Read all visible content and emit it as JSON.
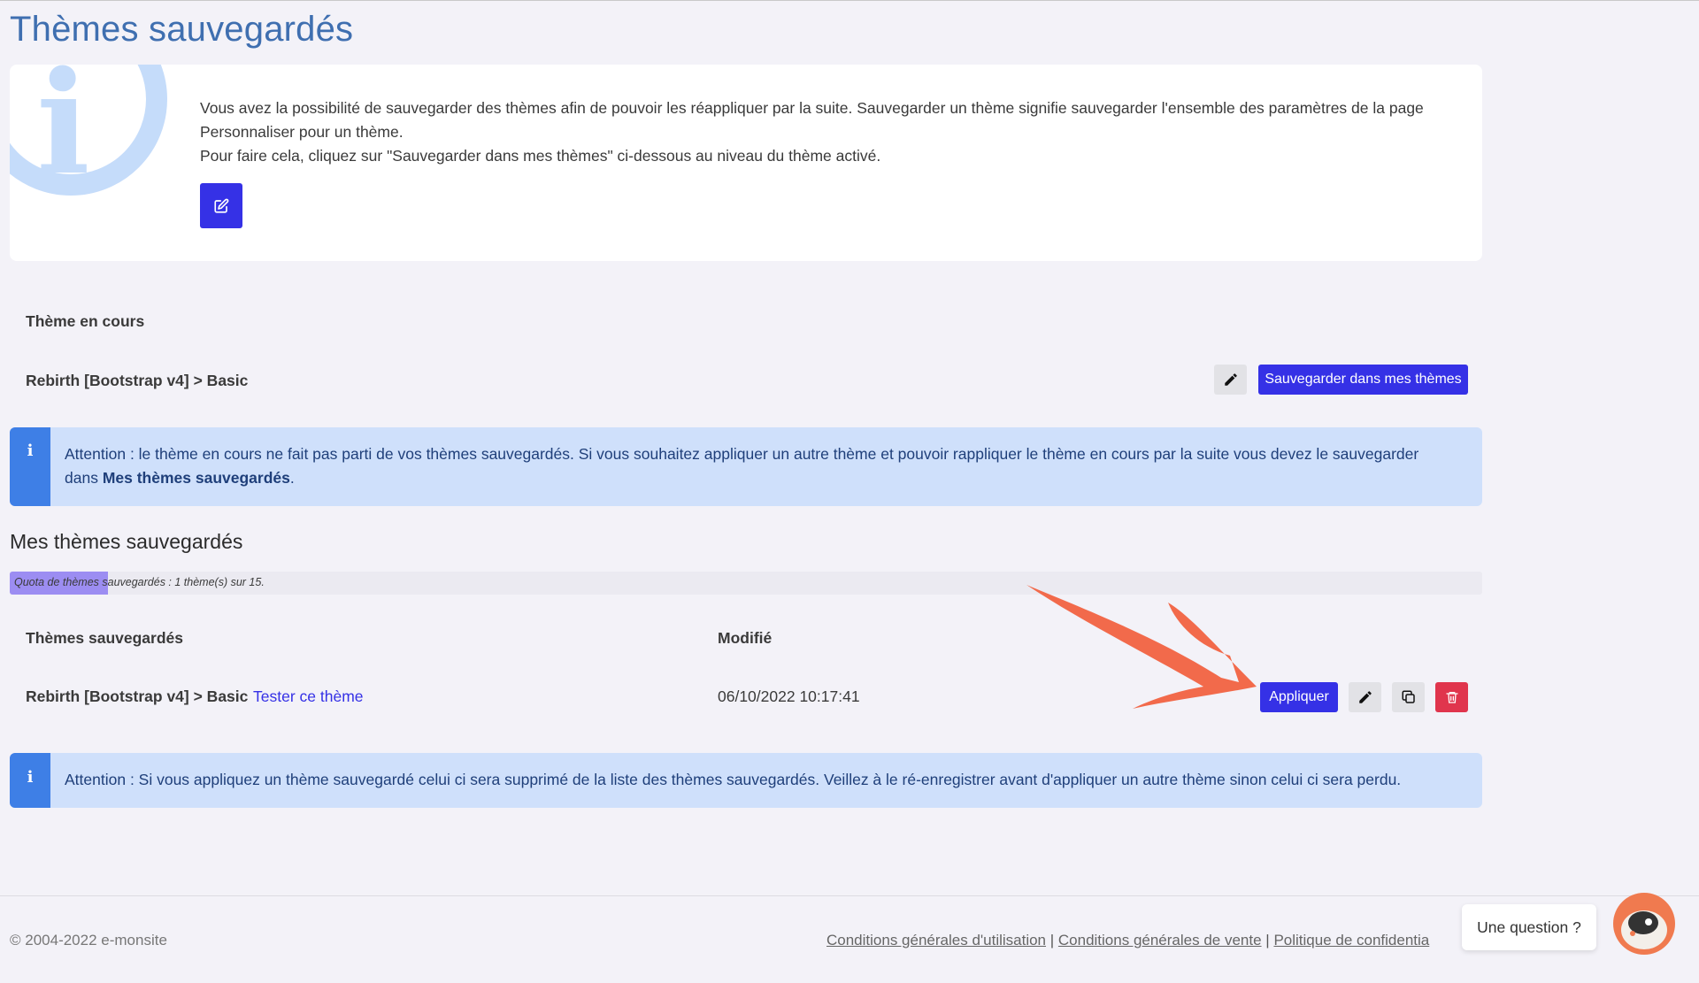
{
  "page": {
    "title": "Thèmes sauvegardés"
  },
  "info": {
    "line1": "Vous avez la possibilité de sauvegarder des thèmes afin de pouvoir les réappliquer par la suite. Sauvegarder un thème signifie sauvegarder l'ensemble des paramètres de la page Personnaliser pour un thème.",
    "line2": "Pour faire cela, cliquez sur \"Sauvegarder dans mes thèmes\" ci-dessous au niveau du thème activé.",
    "icon": "info-icon"
  },
  "current_theme": {
    "heading": "Thème en cours",
    "name": "Rebirth [Bootstrap v4] > Basic",
    "save_label": "Sauvegarder dans mes thèmes"
  },
  "alert1": {
    "prefix": "Attention : le thème en cours ne fait pas parti de vos thèmes sauvegardés. Si vous souhaitez appliquer un autre thème et pouvoir rappliquer le thème en cours par la suite vous devez le sauvegarder dans ",
    "bold": "Mes thèmes sauvegardés",
    "suffix": "."
  },
  "saved": {
    "title": "Mes thèmes sauvegardés",
    "quota_text": "Quota de thèmes sauvegardés : 1 thème(s) sur 15.",
    "quota_used": 1,
    "quota_max": 15,
    "col_name": "Thèmes sauvegardés",
    "col_modified": "Modifié",
    "rows": [
      {
        "name": "Rebirth [Bootstrap v4] > Basic",
        "test_link": "Tester ce thème",
        "modified": "06/10/2022 10:17:41",
        "apply_label": "Appliquer"
      }
    ]
  },
  "alert2": {
    "text": "Attention : Si vous appliquez un thème sauvegardé celui ci sera supprimé de la liste des thèmes sauvegardés. Veillez à le ré-enregistrer avant d'appliquer un autre thème sinon celui ci sera perdu."
  },
  "footer": {
    "copyright": "© 2004-2022 e-monsite",
    "links": [
      "Conditions générales d'utilisation",
      "Conditions générales de vente",
      "Politique de confidentia"
    ],
    "separator": " | "
  },
  "chat": {
    "question_label": "Une question ?"
  },
  "colors": {
    "primary": "#3531e6",
    "danger": "#e0354d",
    "alert_bg": "#cfe0fb",
    "alert_bar": "#3e7fe6",
    "annotation_arrow": "#f26a4b"
  }
}
